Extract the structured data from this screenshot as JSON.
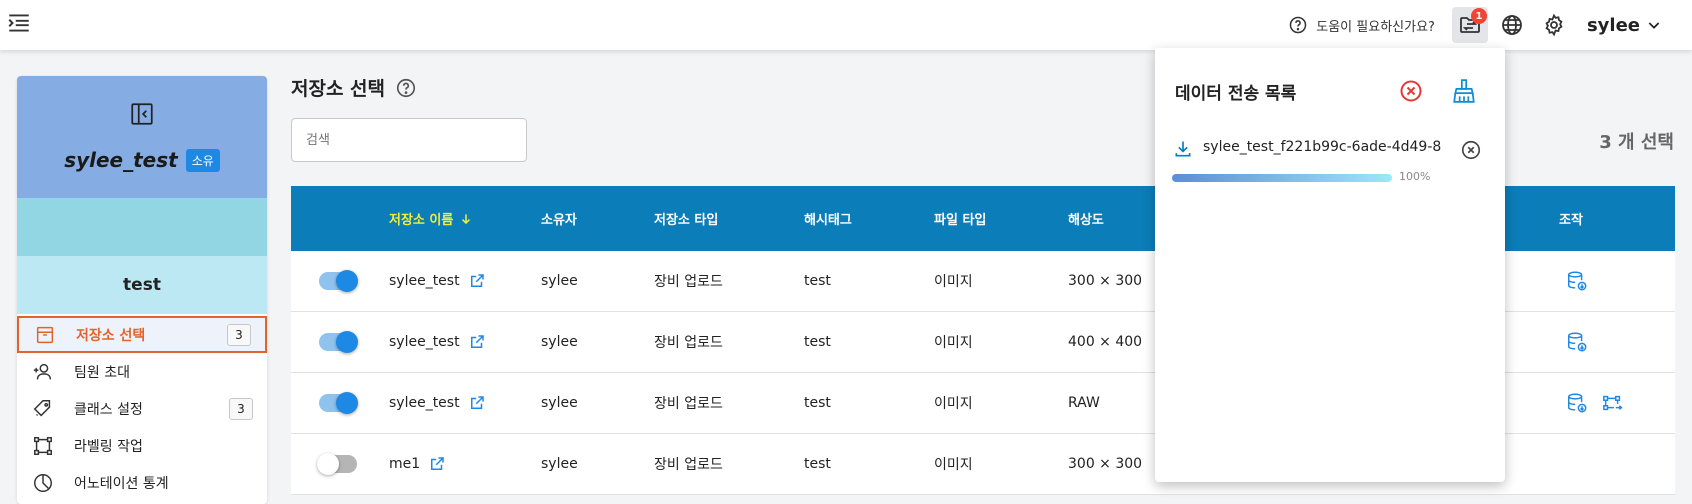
{
  "header": {
    "help_text": "도움이 필요하신가요?",
    "notification_count": "1",
    "user_name": "sylee"
  },
  "sidebar": {
    "project_name": "sylee_test",
    "owner_badge": "소유",
    "team_name": "test",
    "items": [
      {
        "label": "저장소 선택",
        "count": "3",
        "icon": "archive-box-icon",
        "active": true
      },
      {
        "label": "팀원 초대",
        "icon": "person-add-icon"
      },
      {
        "label": "클래스 설정",
        "count": "3",
        "icon": "tags-icon"
      },
      {
        "label": "라벨링 작업",
        "icon": "bounding-box-icon"
      },
      {
        "label": "어노테이션 통계",
        "icon": "pie-chart-icon"
      }
    ]
  },
  "main": {
    "title": "저장소 선택",
    "search_placeholder": "검색",
    "selected_count": "3 개 선택",
    "columns": {
      "name": "저장소 이름",
      "owner": "소유자",
      "type": "저장소 타입",
      "hashtag": "해시태그",
      "file_type": "파일 타입",
      "resolution": "해상도",
      "actions": "조작"
    },
    "rows": [
      {
        "enabled": true,
        "name": "sylee_test",
        "owner": "sylee",
        "type": "장비 업로드",
        "hashtag": "test",
        "file_type": "이미지",
        "resolution": "300 × 300",
        "actions": [
          "database-download-icon"
        ]
      },
      {
        "enabled": true,
        "name": "sylee_test",
        "owner": "sylee",
        "type": "장비 업로드",
        "hashtag": "test",
        "file_type": "이미지",
        "resolution": "400 × 400",
        "actions": [
          "database-download-icon"
        ]
      },
      {
        "enabled": true,
        "name": "sylee_test",
        "owner": "sylee",
        "type": "장비 업로드",
        "hashtag": "test",
        "file_type": "이미지",
        "resolution": "RAW",
        "actions": [
          "database-download-icon",
          "image-convert-icon"
        ]
      },
      {
        "enabled": false,
        "name": "me1",
        "owner": "sylee",
        "type": "장비 업로드",
        "hashtag": "test",
        "file_type": "이미지",
        "resolution": "300 × 300",
        "actions": []
      }
    ]
  },
  "transfer_panel": {
    "title": "데이터 전송 목록",
    "items": [
      {
        "file_name": "sylee_test_f221b99c-6ade-4d49-8",
        "progress_label": "100%",
        "progress": 1.0
      }
    ]
  },
  "colors": {
    "table_header": "#0b7db8",
    "accent": "#1e88e5",
    "active_menu": "#e0652a",
    "danger": "#e53935",
    "sort_highlight": "#f1ef3a"
  }
}
